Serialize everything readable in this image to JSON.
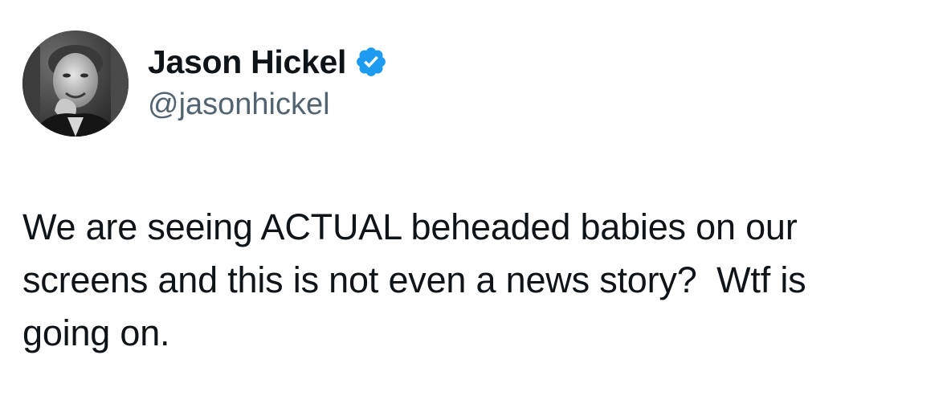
{
  "author": {
    "display_name": "Jason Hickel",
    "handle": "@jasonhickel",
    "verified": true,
    "verified_badge_color": "#1d9bf0",
    "avatar_icon": "profile-photo-grayscale"
  },
  "tweet": {
    "lines": [
      "We are seeing ACTUAL beheaded babies on our",
      "screens and this is not even a news story?  Wtf is",
      "going on."
    ]
  },
  "colors": {
    "text_primary": "#0f1419",
    "text_secondary": "#536471",
    "background": "#ffffff"
  }
}
